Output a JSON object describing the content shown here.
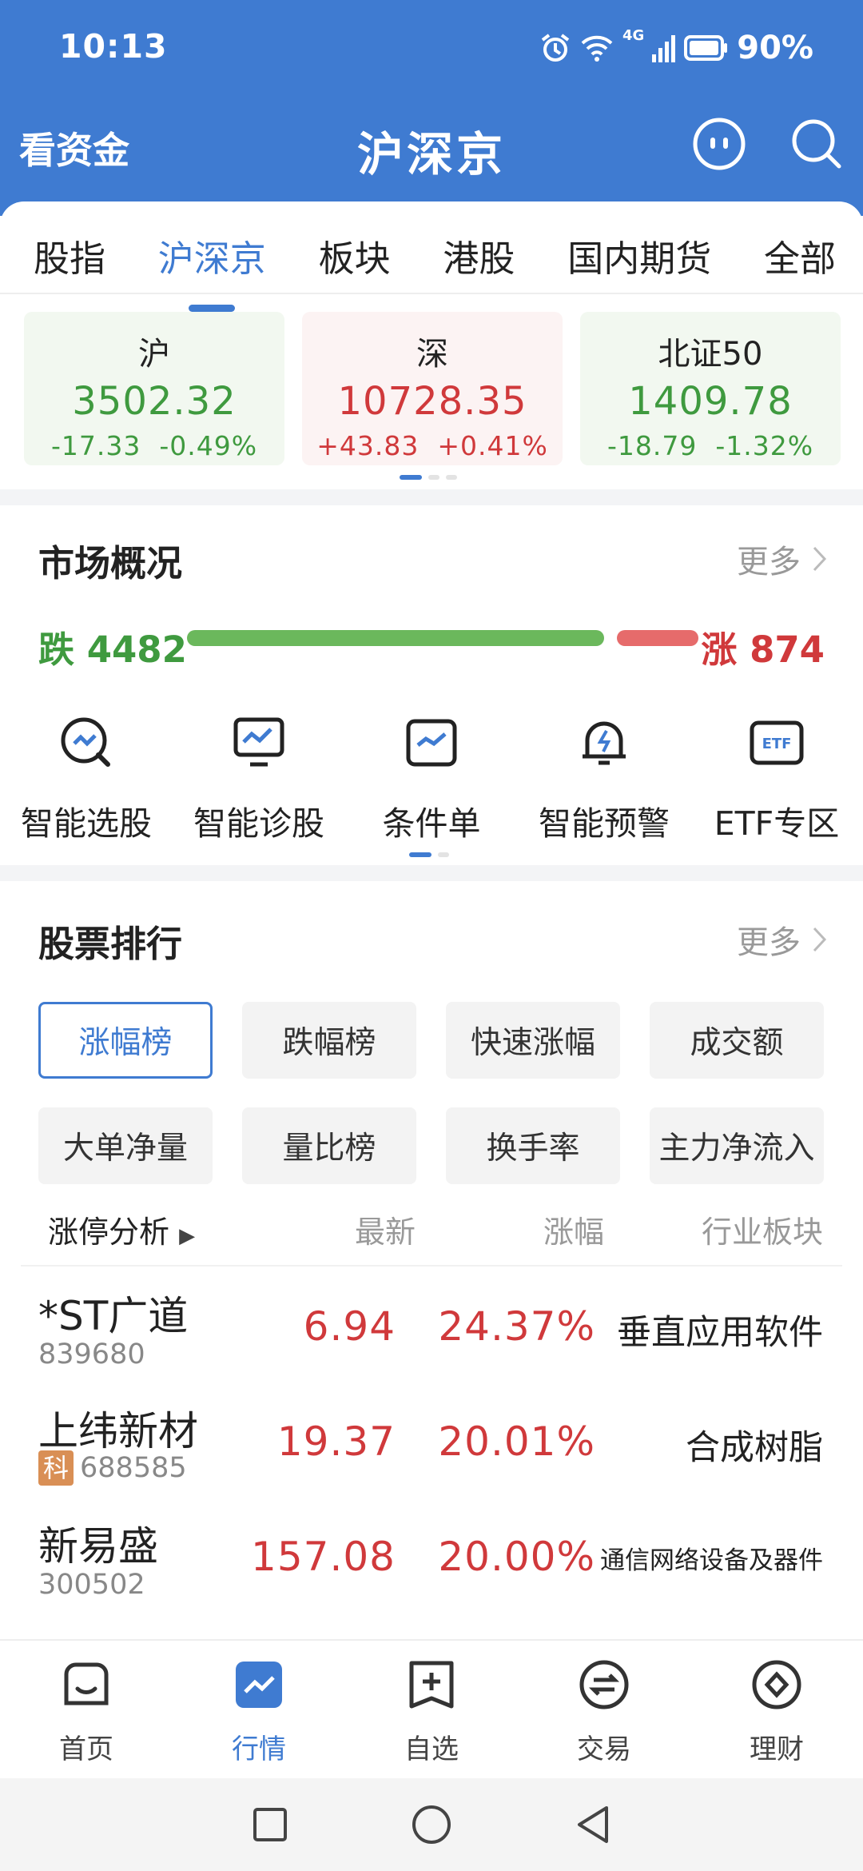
{
  "status": {
    "time": "10:13",
    "battery": "90%",
    "network": "4G"
  },
  "header": {
    "left": "看资金",
    "title": "沪深京"
  },
  "tabs": [
    "股指",
    "沪深京",
    "板块",
    "港股",
    "国内期货",
    "全部"
  ],
  "indices": [
    {
      "name": "沪",
      "price": "3502.32",
      "change": "-17.33",
      "pct": "-0.49%"
    },
    {
      "name": "深",
      "price": "10728.35",
      "change": "+43.83",
      "pct": "+0.41%"
    },
    {
      "name": "北证50",
      "price": "1409.78",
      "change": "-18.79",
      "pct": "-1.32%"
    }
  ],
  "market": {
    "title": "市场概况",
    "more": "更多",
    "fall_label": "跌",
    "fall_count": "4482",
    "rise_label": "涨",
    "rise_count": "874",
    "fall_ratio": 0.837
  },
  "tools": [
    "智能选股",
    "智能诊股",
    "条件单",
    "智能预警",
    "ETF专区"
  ],
  "ranking": {
    "title": "股票排行",
    "more": "更多",
    "chips": [
      "涨幅榜",
      "跌幅榜",
      "快速涨幅",
      "成交额",
      "大单净量",
      "量比榜",
      "换手率",
      "主力净流入"
    ],
    "header": {
      "name": "涨停分析",
      "price": "最新",
      "pct": "涨幅",
      "ind": "行业板块"
    },
    "rows": [
      {
        "name": "*ST广道",
        "code": "839680",
        "badge": "",
        "price": "6.94",
        "pct": "24.37%",
        "industry": "垂直应用软件"
      },
      {
        "name": "上纬新材",
        "code": "688585",
        "badge": "科",
        "price": "19.37",
        "pct": "20.01%",
        "industry": "合成树脂"
      },
      {
        "name": "新易盛",
        "code": "300502",
        "badge": "",
        "price": "157.08",
        "pct": "20.00%",
        "industry": "通信网络设备及器件"
      }
    ]
  },
  "nav": [
    "首页",
    "行情",
    "自选",
    "交易",
    "理财"
  ],
  "colors": {
    "brand": "#3f7bd1",
    "up": "#d0393b",
    "down": "#3f9a3f"
  }
}
